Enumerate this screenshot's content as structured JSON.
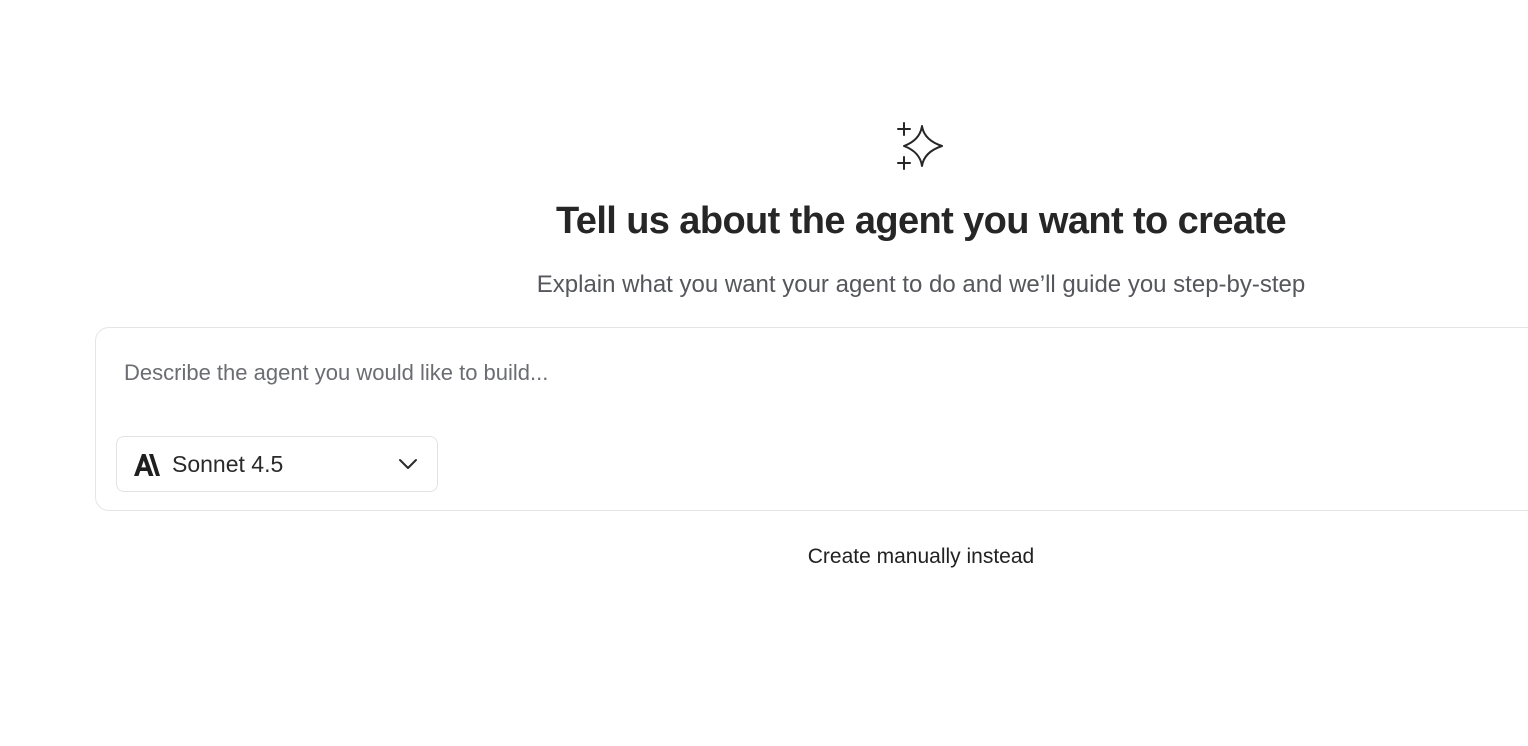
{
  "header": {
    "icon": "sparkle-icon",
    "title": "Tell us about the agent you want to create",
    "subtitle": "Explain what you want your agent to do and we’ll guide you step-by-step"
  },
  "composer": {
    "input_value": "",
    "placeholder": "Describe the agent you would like to build...",
    "model_select": {
      "brand_icon": "anthropic-logo-icon",
      "selected": "Sonnet 4.5",
      "chevron_icon": "chevron-down-icon"
    }
  },
  "footer": {
    "manual_link": "Create manually instead"
  },
  "colors": {
    "title": "#262626",
    "subtitle": "#55575c",
    "border": "#e5e5e8",
    "placeholder": "#6b6d73"
  }
}
